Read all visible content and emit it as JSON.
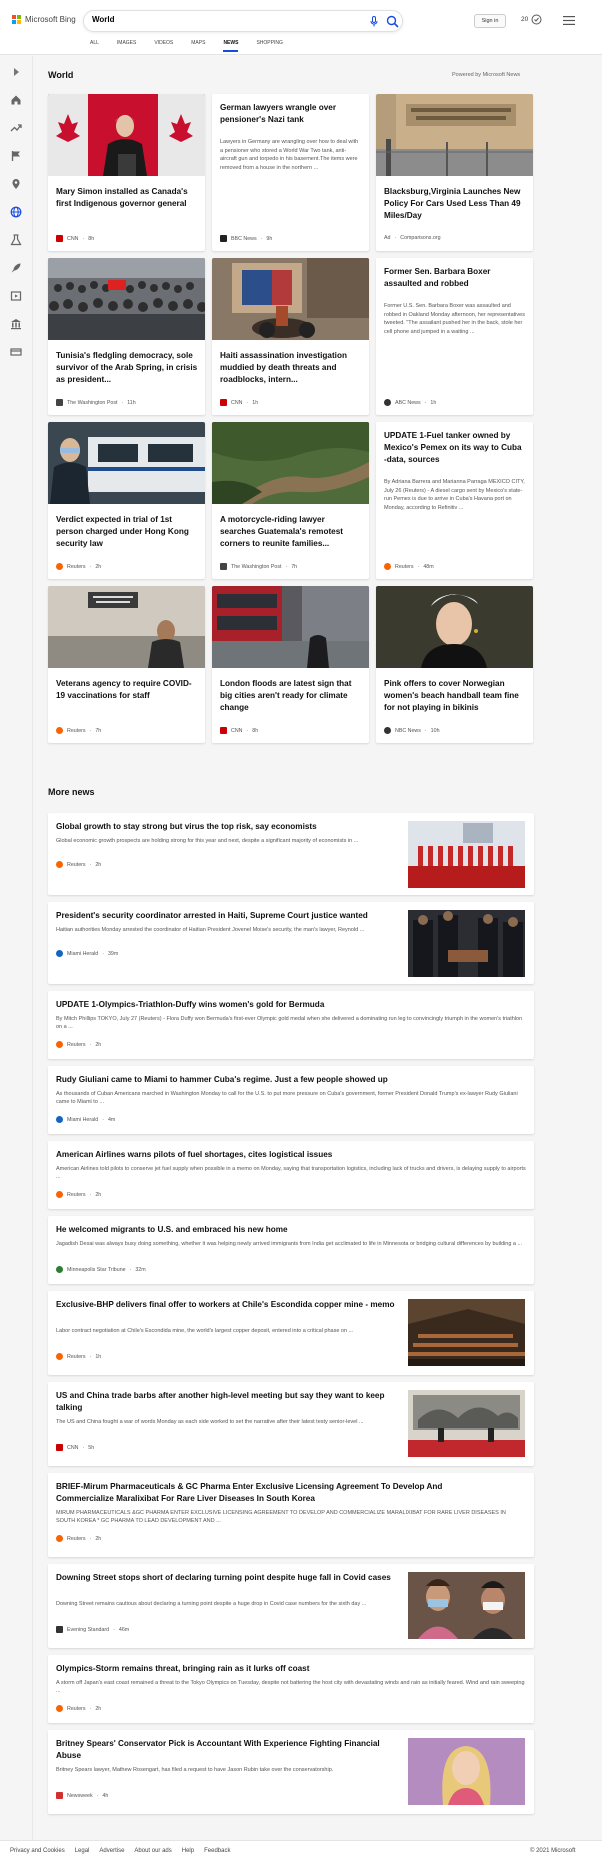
{
  "header": {
    "brand": "Microsoft Bing",
    "search_value": "World",
    "sign_in": "Sign in",
    "rewards_count": "20",
    "tabs": [
      {
        "label": "ALL"
      },
      {
        "label": "IMAGES"
      },
      {
        "label": "VIDEOS"
      },
      {
        "label": "MAPS"
      },
      {
        "label": "NEWS"
      },
      {
        "label": "SHOPPING"
      }
    ],
    "active_tab": "NEWS"
  },
  "colors": {
    "accent": "#174ae4",
    "brand_red": "#f25022",
    "brand_green": "#7fba00",
    "brand_blue": "#00a4ef",
    "brand_yellow": "#ffb900"
  },
  "sidebar": {
    "icons": [
      "expand-icon",
      "home-icon",
      "trending-icon",
      "flag-icon",
      "location-icon",
      "globe-icon",
      "science-icon",
      "rocket-icon",
      "entertainment-icon",
      "politics-icon",
      "money-icon"
    ]
  },
  "world": {
    "title": "World",
    "powered_by": "Powered by Microsoft News",
    "cards": [
      {
        "title": "Mary Simon installed as Canada's first Indigenous governor general",
        "desc": "",
        "source": "CNN",
        "time": "8h",
        "image": "canada-flags"
      },
      {
        "title": "German lawyers wrangle over pensioner's Nazi tank",
        "desc": "Lawyers in Germany are wrangling over how to deal with a pensioner who stored a World War Two tank, anti-aircraft gun and torpedo in his basement.The items were removed from a house in the northern ...",
        "source": "BBC News",
        "time": "9h",
        "image": ""
      },
      {
        "title": "Blacksburg,Virginia Launches New Policy For Cars Used Less Than 49 Miles/Day",
        "desc": "",
        "source": "Comparisons.org",
        "time": "",
        "ad": "Ad",
        "image": "dmv-building"
      },
      {
        "title": "Tunisia's fledgling democracy, sole survivor of the Arab Spring, in crisis as president...",
        "desc": "",
        "source": "The Washington Post",
        "time": "11h",
        "image": "crowd"
      },
      {
        "title": "Haiti assassination investigation muddied by death threats and roadblocks, intern...",
        "desc": "",
        "source": "CNN",
        "time": "1h",
        "image": "haiti-street"
      },
      {
        "title": "Former Sen. Barbara Boxer assaulted and robbed",
        "desc": "Former U.S. Sen. Barbara Boxer was assaulted and robbed in Oakland Monday afternoon, her representatives tweeted. \"The assailant pushed her in the back, stole her cell phone and jumped in a waiting ...",
        "source": "ABC News",
        "time": "1h",
        "image": ""
      },
      {
        "title": "Verdict expected in trial of 1st person charged under Hong Kong security law",
        "desc": "",
        "source": "Reuters",
        "time": "2h",
        "image": "police-van"
      },
      {
        "title": "A motorcycle-riding lawyer searches Guatemala's remotest corners to reunite families...",
        "desc": "",
        "source": "The Washington Post",
        "time": "7h",
        "image": "hillside-road"
      },
      {
        "title": "UPDATE 1-Fuel tanker owned by Mexico's Pemex on its way to Cuba -data, sources",
        "desc": "By Adriana Barrera and Marianna Parraga MEXICO CITY, July 26 (Reuters) - A diesel cargo sent by Mexico's state-run Pemex is due to arrive in Cuba's Havana port on Monday, according to Refinitiv ...",
        "source": "Reuters",
        "time": "48m",
        "image": ""
      },
      {
        "title": "Veterans agency to require COVID-19 vaccinations for staff",
        "desc": "",
        "source": "Reuters",
        "time": "7h",
        "image": "va-building"
      },
      {
        "title": "London floods are latest sign that big cities aren't ready for climate change",
        "desc": "",
        "source": "CNN",
        "time": "8h",
        "image": "flooded-street"
      },
      {
        "title": "Pink offers to cover Norwegian women's beach handball team fine for not playing in bikinis",
        "desc": "",
        "source": "NBC News",
        "time": "10h",
        "image": "pink-portrait"
      }
    ]
  },
  "more_news": {
    "title": "More news",
    "items": [
      {
        "title": "Global growth to stay strong but virus the top risk, say economists",
        "desc": "Global economic growth prospects are holding strong for this year and next, despite a significant majority of economists in ...",
        "source": "Reuters",
        "time": "2h",
        "image": "lab-vials"
      },
      {
        "title": "President's security coordinator arrested in Haiti, Supreme Court justice wanted",
        "desc": "Haitian authorities Monday arrested the coordinator of Haitian President Jovenel Moise's security, the man's lawyer, Reynold ...",
        "source": "Miami Herald",
        "time": "39m",
        "image": "honor-guard"
      },
      {
        "title": "UPDATE 1-Olympics-Triathlon-Duffy wins women's gold for Bermuda",
        "desc": "By Mitch Phillips TOKYO, July 27 (Reuters) - Flora Duffy won Bermuda's first-ever Olympic gold medal when she delivered a dominating run leg to convincingly triumph in the women's triathlon on a ...",
        "source": "Reuters",
        "time": "2h",
        "image": ""
      },
      {
        "title": "Rudy Giuliani came to Miami to hammer Cuba's regime. Just a few people showed up",
        "desc": "As thousands of Cuban Americans marched in Washington Monday to call for the U.S. to put more pressure on Cuba's government, former President Donald Trump's ex-lawyer Rudy Giuliani came to Miami to ...",
        "source": "Miami Herald",
        "time": "4m",
        "image": ""
      },
      {
        "title": "American Airlines warns pilots of fuel shortages, cites logistical issues",
        "desc": "American Airlines told pilots to conserve jet fuel supply when possible in a memo on Monday, saying that transportation logistics, including lack of trucks and drivers, is delaying supply to airports ...",
        "source": "Reuters",
        "time": "2h",
        "image": ""
      },
      {
        "title": "He welcomed migrants to U.S. and embraced his new home",
        "desc": "Jagadish Desai was always busy doing something, whether it was helping newly arrived immigrants from India get acclimated to life in Minnesota or bridging cultural differences by building a ...",
        "source": "Minneapolis Star Tribune",
        "time": "32m",
        "image": ""
      },
      {
        "title": "Exclusive-BHP delivers final offer to workers at Chile's Escondida copper mine - memo",
        "desc": "Labor contract negotiation at Chile's Escondida mine, the world's largest copper deposit, entered into a critical phase on ...",
        "source": "Reuters",
        "time": "1h",
        "image": "copper-plant"
      },
      {
        "title": "US and China trade barbs after another high-level meeting but say they want to keep talking",
        "desc": "The US and China fought a war of words Monday as each side worked to set the narrative after their latest testy senior-level ...",
        "source": "CNN",
        "time": "5h",
        "image": "diplomats"
      },
      {
        "title": "BRIEF-Mirum Pharmaceuticals & GC Pharma Enter Exclusive Licensing Agreement To Develop And Commercialize Maralixibat For Rare Liver Diseases In South Korea",
        "desc": "MIRUM PHARMACEUTICALS &GC PHARMA ENTER EXCLUSIVE LICENSING AGREEMENT TO DEVELOP AND COMMERCIALIZE MARALIXIBAT FOR RARE LIVER DISEASES IN SOUTH KOREA * GC PHARMA TO LEAD DEVELOPMENT AND ...",
        "source": "Reuters",
        "time": "2h",
        "image": ""
      },
      {
        "title": "Downing Street stops short of declaring turning point despite huge fall in Covid cases",
        "desc": "Downing Street remains cautious about declaring a turning point despite a huge drop in Covid case numbers for the sixth day ...",
        "source": "Evening Standard",
        "time": "46m",
        "image": "masked-crowd"
      },
      {
        "title": "Olympics-Storm remains threat, bringing rain as it lurks off coast",
        "desc": "A storm off Japan's east coast remained a threat to the Tokyo Olympics on Tuesday, despite not battering the host city with devastating winds and rain as initially feared. Wind and rain sweeping ...",
        "source": "Reuters",
        "time": "2h",
        "image": ""
      },
      {
        "title": "Britney Spears' Conservator Pick is Accountant With Experience Fighting Financial Abuse",
        "desc": "Britney Spears lawyer, Mathew Rosengart, has filed a request to have Jason Rubin take over the conservatorship.",
        "source": "Newsweek",
        "time": "4h",
        "image": "britney-portrait"
      }
    ]
  },
  "footer": {
    "links": [
      "Privacy and Cookies",
      "Legal",
      "Advertise",
      "About our ads",
      "Help",
      "Feedback"
    ],
    "copyright": "© 2021 Microsoft"
  }
}
